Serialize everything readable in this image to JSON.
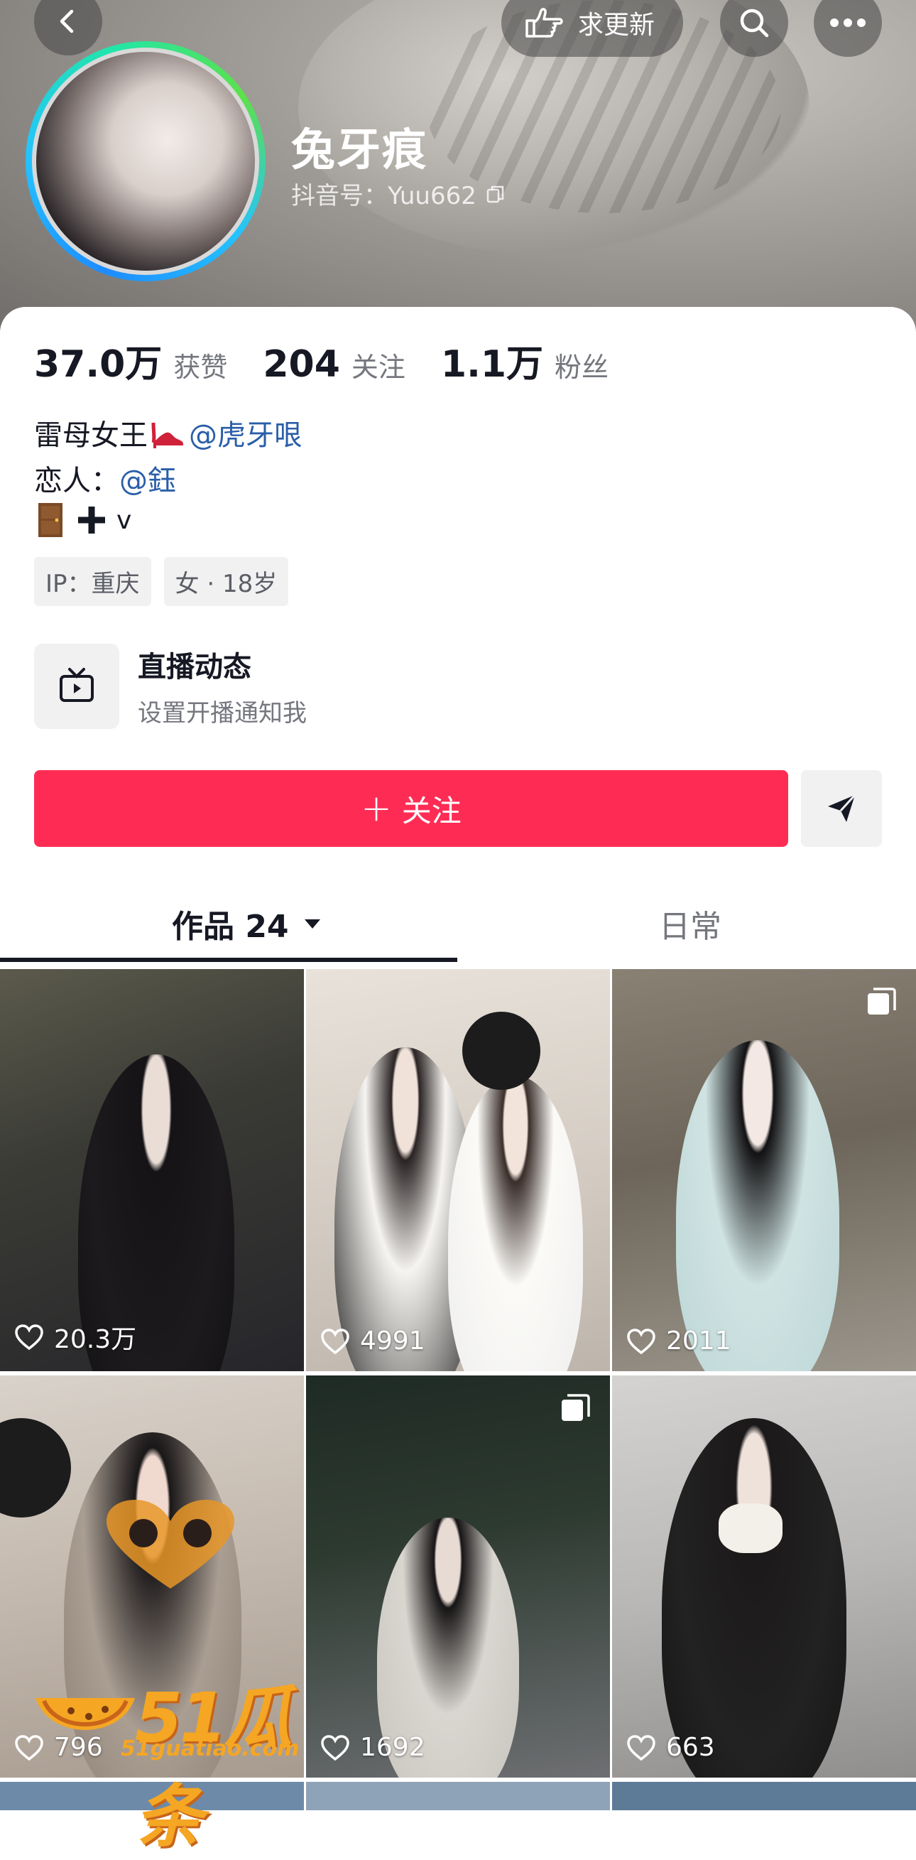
{
  "header": {
    "request_update_label": "求更新",
    "nickname": "兔牙痕",
    "douyin_id": "抖音号：Yuu662"
  },
  "stats": [
    {
      "num": "37.0万",
      "label": "获赞"
    },
    {
      "num": "204",
      "label": "关注"
    },
    {
      "num": "1.1万",
      "label": "粉丝"
    }
  ],
  "bio": {
    "line1_text": "雷母女王",
    "line1_mention": "@虎牙哏",
    "line2_prefix": "恋人：",
    "line2_mention": "@鈺",
    "line3_text": "v"
  },
  "tags": [
    "IP：重庆",
    "女 · 18岁"
  ],
  "live": {
    "title": "直播动态",
    "subtitle": "设置开播通知我"
  },
  "follow_label": "关注",
  "tabs": {
    "works": "作品 24",
    "daily": "日常"
  },
  "videos": [
    {
      "likes": "20.3万",
      "multi": false
    },
    {
      "likes": "4991",
      "multi": false
    },
    {
      "likes": "2011",
      "multi": true
    },
    {
      "likes": "796",
      "multi": false
    },
    {
      "likes": "1692",
      "multi": true
    },
    {
      "likes": "663",
      "multi": false
    }
  ],
  "watermark": {
    "brand": "51瓜条",
    "domain": "51guatiao.com"
  },
  "colors": {
    "accent": "#fe2c55",
    "mention": "#2a5ea8"
  }
}
